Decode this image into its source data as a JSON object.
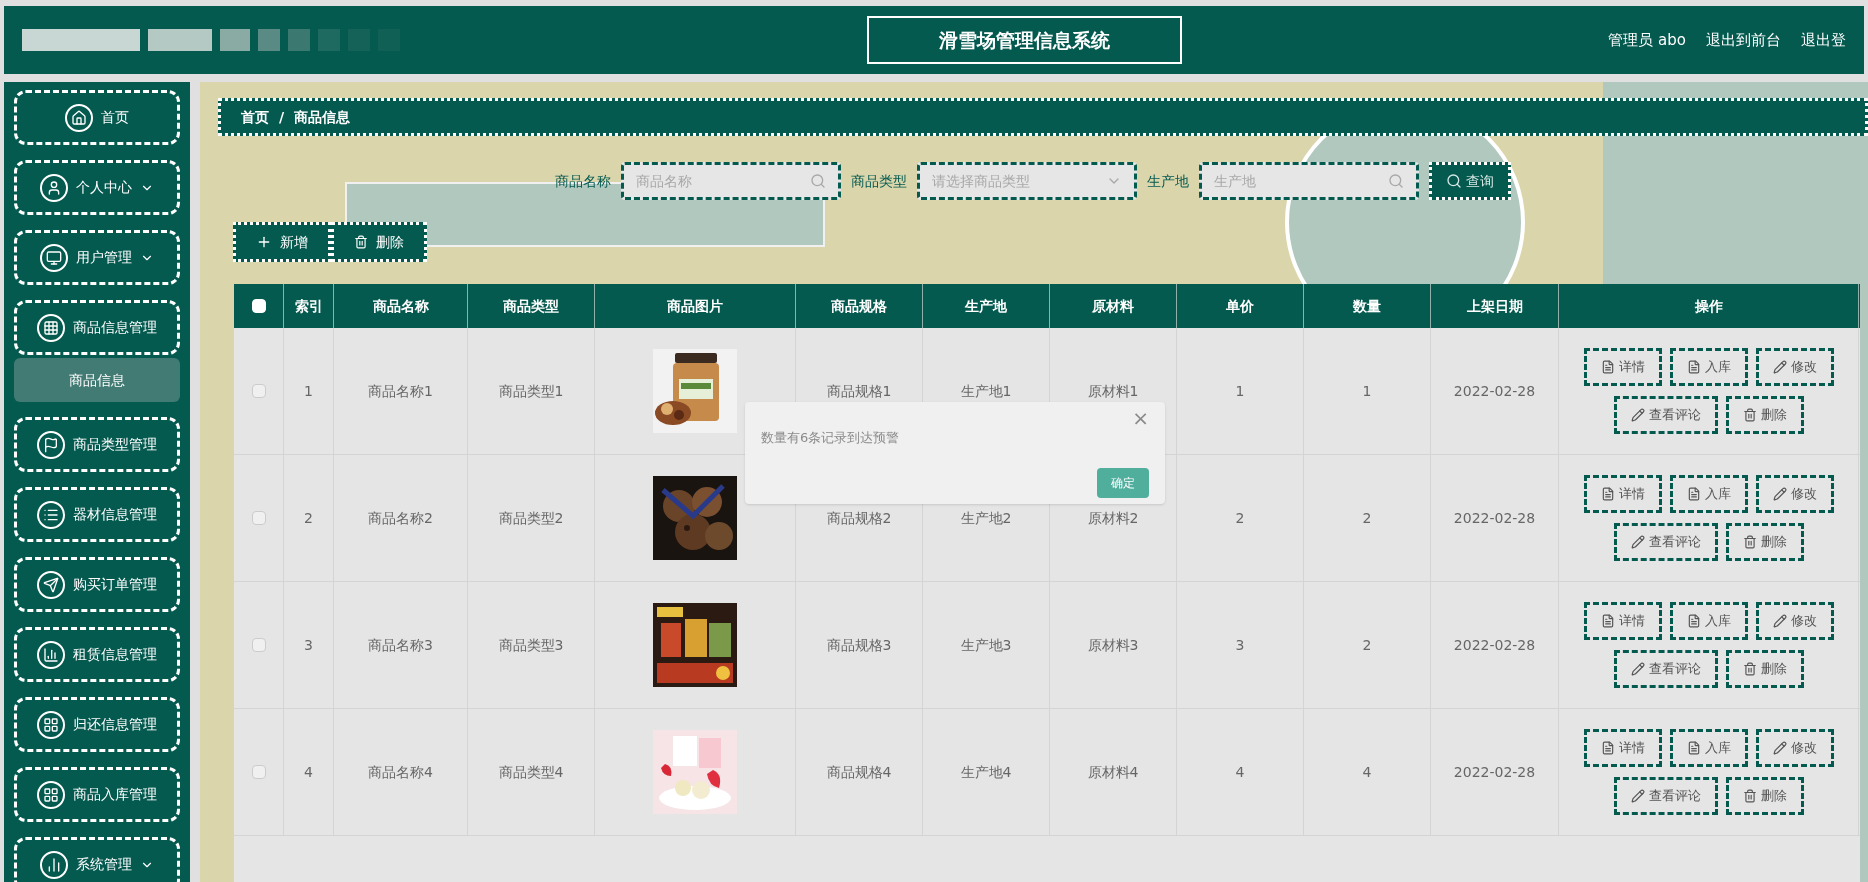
{
  "header": {
    "title": "滑雪场管理信息系统",
    "user": "管理员 abo",
    "links": [
      "退出到前台",
      "退出登"
    ]
  },
  "sidebar": {
    "items": [
      {
        "label": "首页"
      },
      {
        "label": "个人中心",
        "expanded": false
      },
      {
        "label": "用户管理",
        "expanded": false
      },
      {
        "label": "商品信息管理",
        "expanded": true,
        "children": [
          {
            "label": "商品信息",
            "selected": true
          }
        ]
      },
      {
        "label": "商品类型管理"
      },
      {
        "label": "器材信息管理"
      },
      {
        "label": "购买订单管理"
      },
      {
        "label": "租赁信息管理"
      },
      {
        "label": "归还信息管理"
      },
      {
        "label": "商品入库管理"
      },
      {
        "label": "系统管理",
        "expanded": false
      }
    ]
  },
  "breadcrumb": {
    "items": [
      "首页",
      "商品信息"
    ],
    "separator": "/"
  },
  "search": {
    "fields": [
      {
        "label": "商品名称",
        "placeholder": "商品名称",
        "kind": "text"
      },
      {
        "label": "商品类型",
        "placeholder": "请选择商品类型",
        "kind": "select"
      },
      {
        "label": "生产地",
        "placeholder": "生产地",
        "kind": "text"
      }
    ],
    "button": "查询"
  },
  "actions": [
    {
      "label": "新增",
      "kind": "add"
    },
    {
      "label": "删除",
      "kind": "delete"
    }
  ],
  "table": {
    "all_checked": false,
    "columns": [
      "索引",
      "商品名称",
      "商品类型",
      "商品图片",
      "商品规格",
      "生产地",
      "原材料",
      "单价",
      "数量",
      "上架日期",
      "操作"
    ],
    "rows": [
      {
        "checked": false,
        "cells": [
          "1",
          "商品名称1",
          "商品类型1",
          "",
          "商品规格1",
          "生产地1",
          "原材料1",
          "1",
          "1",
          "2022-02-28"
        ],
        "buttons": [
          {
            "label": "详情",
            "kind": "doc"
          },
          {
            "label": "入库",
            "kind": "doc"
          },
          {
            "label": "修改",
            "kind": "edit"
          },
          {
            "label": "查看评论",
            "kind": "edit"
          },
          {
            "label": "删除",
            "kind": "delete"
          }
        ]
      },
      {
        "checked": false,
        "cells": [
          "2",
          "商品名称2",
          "商品类型2",
          "",
          "商品规格2",
          "生产地2",
          "原材料2",
          "2",
          "2",
          "2022-02-28"
        ],
        "buttons": [
          {
            "label": "详情",
            "kind": "doc"
          },
          {
            "label": "入库",
            "kind": "doc"
          },
          {
            "label": "修改",
            "kind": "edit"
          },
          {
            "label": "查看评论",
            "kind": "edit"
          },
          {
            "label": "删除",
            "kind": "delete"
          }
        ]
      },
      {
        "checked": false,
        "cells": [
          "3",
          "商品名称3",
          "商品类型3",
          "",
          "商品规格3",
          "生产地3",
          "原材料3",
          "3",
          "2",
          "2022-02-28"
        ],
        "buttons": [
          {
            "label": "详情",
            "kind": "doc"
          },
          {
            "label": "入库",
            "kind": "doc"
          },
          {
            "label": "修改",
            "kind": "edit"
          },
          {
            "label": "查看评论",
            "kind": "edit"
          },
          {
            "label": "删除",
            "kind": "delete"
          }
        ]
      },
      {
        "checked": false,
        "cells": [
          "4",
          "商品名称4",
          "商品类型4",
          "",
          "商品规格4",
          "生产地4",
          "原材料4",
          "4",
          "4",
          "2022-02-28"
        ],
        "buttons": [
          {
            "label": "详情",
            "kind": "doc"
          },
          {
            "label": "入库",
            "kind": "doc"
          },
          {
            "label": "修改",
            "kind": "edit"
          },
          {
            "label": "查看评论",
            "kind": "edit"
          },
          {
            "label": "删除",
            "kind": "delete"
          }
        ]
      }
    ]
  },
  "dialog": {
    "message": "数量有6条记录到达预警",
    "close": "×",
    "button": "确定"
  }
}
